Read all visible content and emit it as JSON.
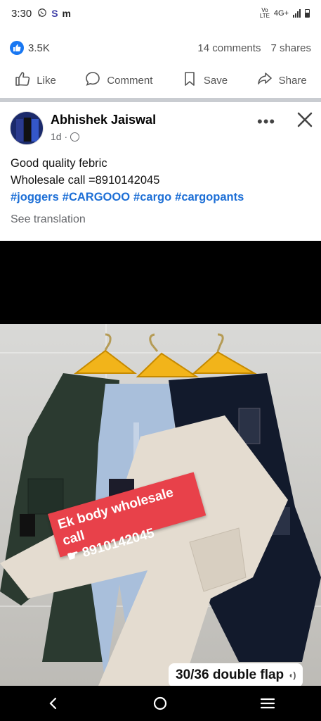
{
  "status_bar": {
    "time": "3:30",
    "app_icons": [
      "whatsapp-icon",
      "s-app-icon",
      "m-app-icon"
    ],
    "s_glyph": "S",
    "m_glyph": "m",
    "volte": "Vo LTE",
    "network": "4G+"
  },
  "reactions": {
    "count": "3.5K",
    "comments": "14 comments",
    "shares": "7 shares"
  },
  "actions": {
    "like": "Like",
    "comment": "Comment",
    "save": "Save",
    "share": "Share"
  },
  "post": {
    "author": "Abhishek Jaiswal",
    "time": "1d ·",
    "lines": [
      "Good quality febric",
      "Wholesale call =8910142045"
    ],
    "hashtags": [
      "#joggers",
      "#CARGOOO",
      "#cargo",
      "#cargopants"
    ],
    "see_translation": "See translation"
  },
  "photo": {
    "promo_line1": "Ek body wholesale call",
    "promo_line2": "8910142045",
    "size_label": "30/36 double flap"
  },
  "colors": {
    "accent": "#1877f2",
    "hashtag": "#1d6fd6",
    "promo": "#e8414a"
  }
}
